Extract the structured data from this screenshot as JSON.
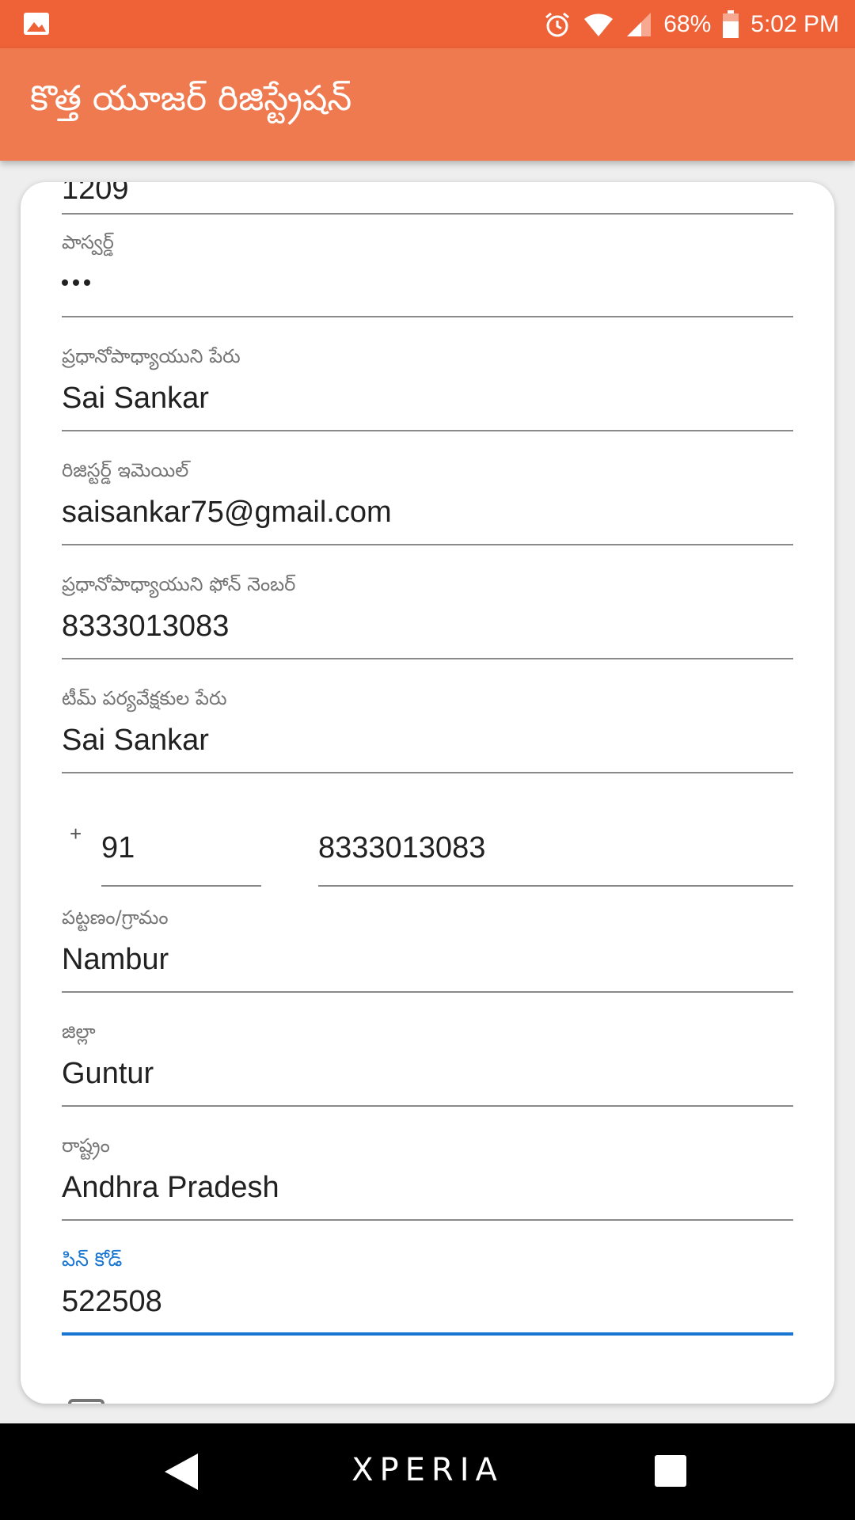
{
  "status_bar": {
    "battery": "68%",
    "time": "5:02 PM"
  },
  "app_bar": {
    "title": "కొత్త యూజర్ రిజిస్ట్రేషన్"
  },
  "form": {
    "top_partial_value": "1209",
    "password": {
      "label": "పాస్వర్డ్"
    },
    "headmaster_name": {
      "label": "ప్రధానోపాధ్యాయుని పేరు",
      "value": "Sai Sankar"
    },
    "registered_email": {
      "label": "రిజిస్టర్డ్ ఇమెయిల్",
      "value": "saisankar75@gmail.com"
    },
    "headmaster_phone": {
      "label": "ప్రధానోపాధ్యాయుని ఫోన్ నెంబర్",
      "value": "8333013083"
    },
    "supervisor_name": {
      "label": "టీమ్ పర్యవేక్షకుల పేరు",
      "value": "Sai Sankar"
    },
    "phone": {
      "plus": "+",
      "country_code": "91",
      "number": "8333013083"
    },
    "town_village": {
      "label": "పట్టణం/గ్రామం",
      "value": "Nambur"
    },
    "district": {
      "label": "జిల్లా",
      "value": "Guntur"
    },
    "state": {
      "label": "రాష్ట్రం",
      "value": "Andhra Pradesh"
    },
    "pin_code": {
      "label": "పిన్ కోడ్",
      "value": "522508"
    }
  },
  "nav_bar": {
    "brand": "XPERIA"
  },
  "colors": {
    "status_bar": "#ef6238",
    "app_bar": "#f07a4f",
    "focus_accent": "#1976d2"
  }
}
